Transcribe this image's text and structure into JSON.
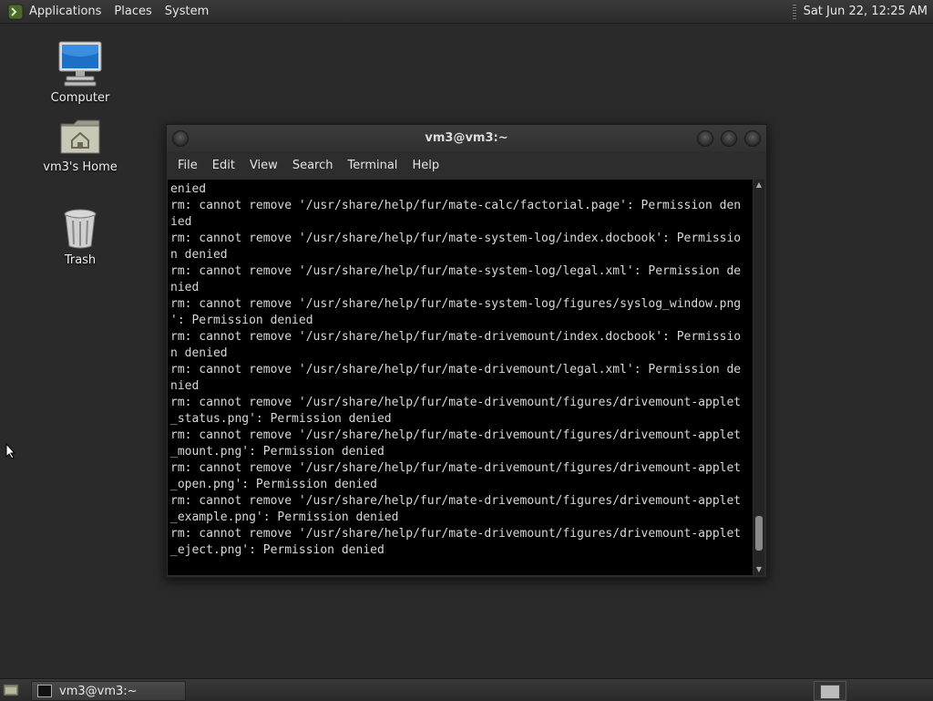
{
  "top_panel": {
    "menus": [
      "Applications",
      "Places",
      "System"
    ],
    "clock": "Sat Jun 22, 12:25 AM"
  },
  "desktop_icons": {
    "computer": "Computer",
    "home": "vm3's Home",
    "trash": "Trash"
  },
  "terminal": {
    "title": "vm3@vm3:~",
    "menu": [
      "File",
      "Edit",
      "View",
      "Search",
      "Terminal",
      "Help"
    ],
    "lines": [
      "enied",
      "rm: cannot remove '/usr/share/help/fur/mate-calc/factorial.page': Permission den",
      "ied",
      "rm: cannot remove '/usr/share/help/fur/mate-system-log/index.docbook': Permissio",
      "n denied",
      "rm: cannot remove '/usr/share/help/fur/mate-system-log/legal.xml': Permission de",
      "nied",
      "rm: cannot remove '/usr/share/help/fur/mate-system-log/figures/syslog_window.png",
      "': Permission denied",
      "rm: cannot remove '/usr/share/help/fur/mate-drivemount/index.docbook': Permissio",
      "n denied",
      "rm: cannot remove '/usr/share/help/fur/mate-drivemount/legal.xml': Permission de",
      "nied",
      "rm: cannot remove '/usr/share/help/fur/mate-drivemount/figures/drivemount-applet",
      "_status.png': Permission denied",
      "rm: cannot remove '/usr/share/help/fur/mate-drivemount/figures/drivemount-applet",
      "_mount.png': Permission denied",
      "rm: cannot remove '/usr/share/help/fur/mate-drivemount/figures/drivemount-applet",
      "_open.png': Permission denied",
      "rm: cannot remove '/usr/share/help/fur/mate-drivemount/figures/drivemount-applet",
      "_example.png': Permission denied",
      "rm: cannot remove '/usr/share/help/fur/mate-drivemount/figures/drivemount-applet",
      "_eject.png': Permission denied"
    ],
    "scroll_position": 0.96
  },
  "taskbar": {
    "window_button": "vm3@vm3:~"
  }
}
